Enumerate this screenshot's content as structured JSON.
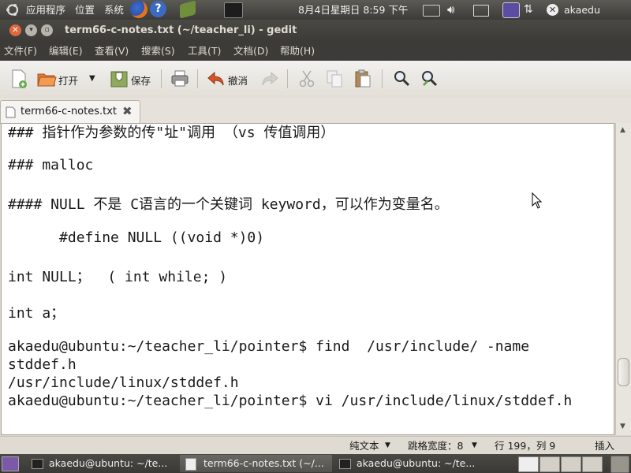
{
  "top_panel": {
    "apps": "应用程序",
    "places": "位置",
    "system": "系统",
    "datetime": "8月4日星期日  8:59 下午",
    "user": "akaedu"
  },
  "window": {
    "title": "term66-c-notes.txt (~/teacher_li) - gedit"
  },
  "menu": [
    "文件(F)",
    "编辑(E)",
    "查看(V)",
    "搜索(S)",
    "工具(T)",
    "文档(D)",
    "帮助(H)"
  ],
  "toolbar": {
    "open_label": "打开",
    "save_label": "保存",
    "undo_label": "撤消"
  },
  "tab": {
    "label": "term66-c-notes.txt"
  },
  "editor_lines": [
    "### 指针作为参数的传\"址\"调用 （vs 传值调用）",
    "### malloc",
    "#### NULL 不是 C语言的一个关键词 keyword，可以作为变量名。",
    "      #define NULL ((void *)0)",
    "int NULL；  ( int while; )",
    "int a；",
    "akaedu@ubuntu:~/teacher_li/pointer$ find  /usr/include/ -name",
    "stddef.h",
    "/usr/include/linux/stddef.h",
    "akaedu@ubuntu:~/teacher_li/pointer$ vi /usr/include/linux/stddef.h"
  ],
  "status": {
    "filetype": "纯文本",
    "tab_width": "跳格宽度：8",
    "position": "行 199，列 9",
    "mode": "插入"
  },
  "taskbar": [
    "akaedu@ubuntu: ~/te...",
    "term66-c-notes.txt (~/...",
    "akaedu@ubuntu: ~/te..."
  ],
  "colors": {
    "accent": "#f07746",
    "panel": "#3c3b37",
    "close_button": "#e0683e"
  }
}
